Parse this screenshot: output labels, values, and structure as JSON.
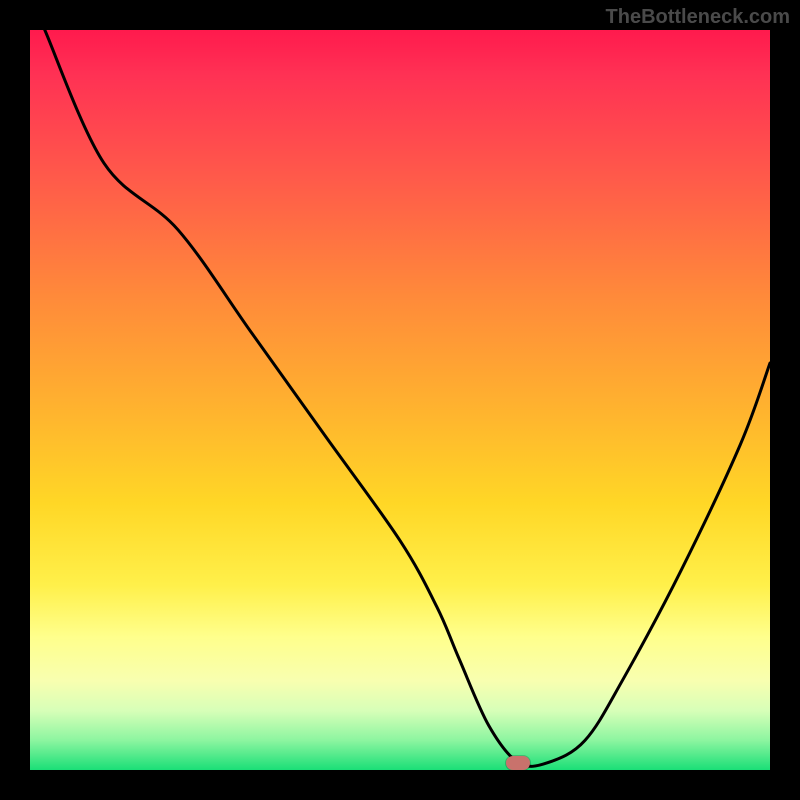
{
  "watermark": "TheBottleneck.com",
  "chart_data": {
    "type": "line",
    "title": "",
    "xlabel": "",
    "ylabel": "",
    "xlim": [
      0,
      100
    ],
    "ylim": [
      0,
      100
    ],
    "x": [
      2,
      10,
      20,
      30,
      40,
      50,
      55,
      58,
      62,
      66,
      70,
      75,
      80,
      88,
      96,
      100
    ],
    "values": [
      100,
      82,
      73,
      59,
      45,
      31,
      22,
      15,
      6,
      1,
      1,
      4,
      12,
      27,
      44,
      55
    ],
    "marker": {
      "x": 66,
      "y": 1
    },
    "note": "values are percent height inside plot; 0 at bottom green edge, 100 at top red edge"
  }
}
